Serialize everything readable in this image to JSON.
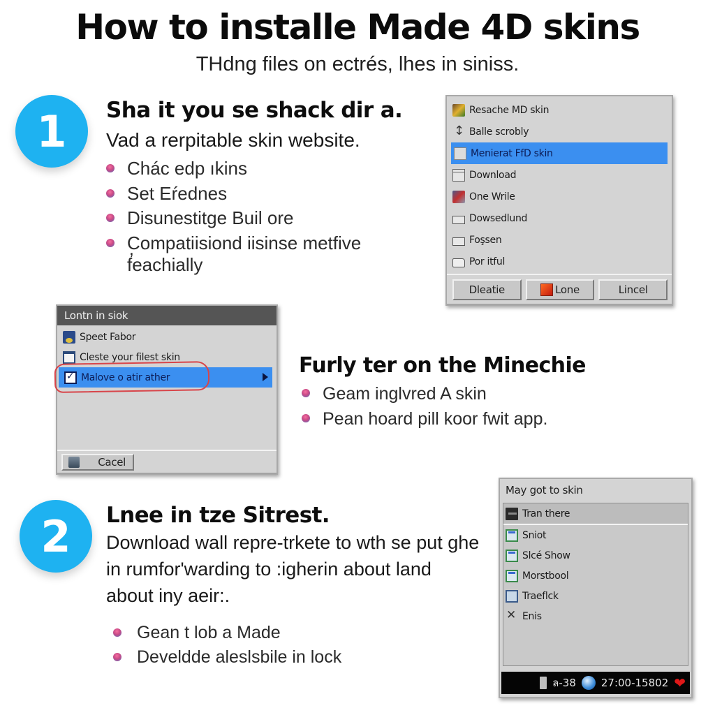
{
  "header": {
    "title": "How to installe Made 4D skins",
    "subtitle": "THdng files on ectrés, lhes in siniss."
  },
  "step1": {
    "number": "1",
    "heading": "Sha it you se shack dir a.",
    "subheading": "Vad a rerpitable skin website.",
    "bullets": [
      "Chác edp ıkins",
      "Set Eŕednes",
      "Disunestitge Buil ore",
      "Compatiisiond iisinse metfive"
    ],
    "bullet_continuation": "f̕eachially"
  },
  "dialog_a": {
    "items": [
      {
        "icon": "skin-image-icon",
        "label": "Resache MD skin"
      },
      {
        "icon": "scroll-arrows-icon",
        "label": "Balle scrobly"
      },
      {
        "icon": "skin-file-icon",
        "label": "Menierat FfD skin",
        "selected": true
      },
      {
        "icon": "window-icon",
        "label": "Download"
      },
      {
        "icon": "paint-icon",
        "label": "One Wrile"
      },
      {
        "icon": "box-icon",
        "label": "Dowsedlund"
      },
      {
        "icon": "box-icon",
        "label": "Foşsen"
      },
      {
        "icon": "folder-icon",
        "label": "Por itful"
      }
    ],
    "buttons": {
      "first": "Dleatie",
      "second": "Lone",
      "third": "Lincel"
    }
  },
  "dialog_b": {
    "title": "Lontn in siok",
    "items": [
      {
        "icon": "monitor-icon",
        "label": "Speet Fabor"
      },
      {
        "icon": "calendar-icon",
        "label": "Cleste your filest skin"
      },
      {
        "icon": "checkbox-icon",
        "label": "Malove o atir ather",
        "selected": true
      }
    ],
    "cancel_label": "Cacel"
  },
  "middle": {
    "heading": "Furly ter on the Minechie",
    "bullets": [
      "Geam inglvred A skin",
      "Pean hoard pill koor fwit app."
    ]
  },
  "step2": {
    "number": "2",
    "heading": "Lnee in tze Sitrest.",
    "paragraph": "Download wall repre-trkete to wth se put ghe in rumfor'warding to :igherin about land about iny aeir:.",
    "bullets": [
      "Gean t lob a Made",
      "Develdde aleslsbile in lock"
    ]
  },
  "dialog_c": {
    "title": "May got to skin",
    "items": [
      {
        "icon": "film-icon",
        "label": "Tran there"
      },
      {
        "icon": "picture-icon",
        "label": "Sniot"
      },
      {
        "icon": "picture-icon",
        "label": "Slcé Show"
      },
      {
        "icon": "picture-icon",
        "label": "Morstbool"
      },
      {
        "icon": "picture-icon",
        "label": "Traeflck"
      },
      {
        "icon": "tools-icon",
        "label": "Enis"
      }
    ],
    "taskbar": {
      "indicator": "ล-38",
      "clock": "27:00-15802"
    }
  },
  "colors": {
    "accent_blue": "#1eb2f1",
    "selection_blue": "#3b8ff0",
    "annotation_red": "#d8454a",
    "dialog_gray": "#d4d4d4"
  }
}
